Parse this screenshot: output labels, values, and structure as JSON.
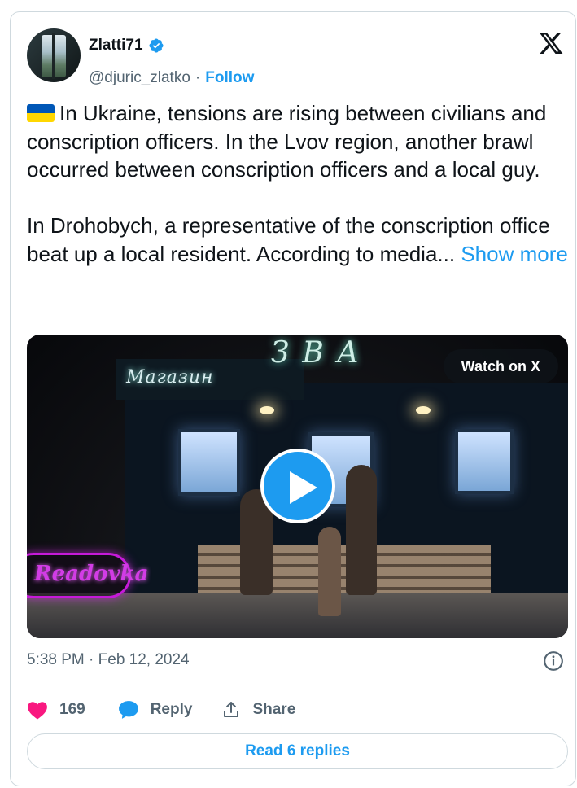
{
  "author": {
    "display_name": "Zlatti71",
    "handle": "@djuric_zlatko",
    "separator": "·",
    "follow_label": "Follow"
  },
  "tweet": {
    "paragraph1": "In Ukraine, tensions are rising between civilians and conscription officers. In the Lvov region, another brawl occurred between conscription officers and a local guy.",
    "paragraph2": "In Drohobych, a representative of the conscription office beat up a local resident. According to media...",
    "show_more_label": "Show more",
    "flag_icon": "ukraine-flag-icon"
  },
  "media": {
    "watch_label": "Watch on X",
    "watermark_text": "Readovka",
    "sign_left": "Магазин",
    "sign_top": "ЗВА"
  },
  "meta": {
    "timestamp": "5:38 PM · Feb 12, 2024"
  },
  "actions": {
    "like_count": "169",
    "reply_label": "Reply",
    "share_label": "Share"
  },
  "footer": {
    "read_replies_label": "Read 6 replies"
  },
  "colors": {
    "accent": "#1d9bf0",
    "like": "#f91880",
    "text": "#0f1419",
    "muted": "#536471",
    "border": "#cfd9de"
  }
}
